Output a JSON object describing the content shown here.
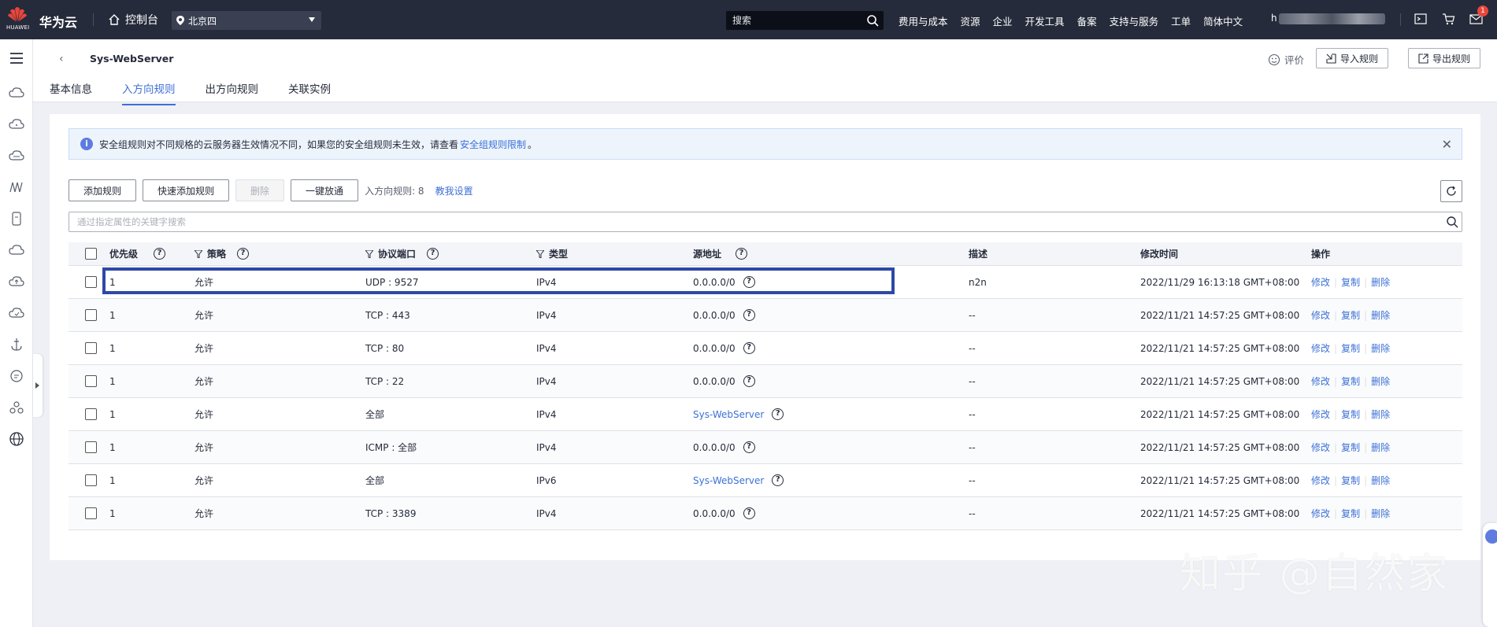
{
  "topbar": {
    "logo_text": "HUAWEI",
    "brand": "华为云",
    "console": "控制台",
    "region": "北京四",
    "search_placeholder": "搜索",
    "nav": [
      "费用与成本",
      "资源",
      "企业",
      "开发工具",
      "备案",
      "支持与服务",
      "工单",
      "简体中文"
    ],
    "user_initial": "h",
    "notification_count": "1"
  },
  "header": {
    "title": "Sys-WebServer",
    "tabs": [
      {
        "label": "基本信息",
        "active": false
      },
      {
        "label": "入方向规则",
        "active": true
      },
      {
        "label": "出方向规则",
        "active": false
      },
      {
        "label": "关联实例",
        "active": false
      }
    ],
    "rate_label": "评价",
    "import_label": "导入规则",
    "export_label": "导出规则"
  },
  "notice": {
    "text": "安全组规则对不同规格的云服务器生效情况不同，如果您的安全组规则未生效，请查看",
    "link": "安全组规则限制",
    "suffix": "。"
  },
  "toolbar": {
    "add": "添加规则",
    "quick_add": "快速添加规则",
    "delete": "删除",
    "allow_all": "一键放通",
    "count": "入方向规则: 8",
    "help": "教我设置"
  },
  "filter_placeholder": "通过指定属性的关键字搜索",
  "table": {
    "headers": {
      "priority": "优先级",
      "policy": "策略",
      "protocol": "协议端口",
      "type": "类型",
      "source": "源地址",
      "desc": "描述",
      "modified": "修改时间",
      "ops": "操作"
    },
    "ops": {
      "edit": "修改",
      "copy": "复制",
      "delete": "删除"
    },
    "rows": [
      {
        "priority": "1",
        "policy": "允许",
        "protocol": "UDP : 9527",
        "type": "IPv4",
        "source": "0.0.0.0/0",
        "desc": "n2n",
        "modified": "2022/11/29 16:13:18 GMT+08:00"
      },
      {
        "priority": "1",
        "policy": "允许",
        "protocol": "TCP : 443",
        "type": "IPv4",
        "source": "0.0.0.0/0",
        "desc": "--",
        "modified": "2022/11/21 14:57:25 GMT+08:00"
      },
      {
        "priority": "1",
        "policy": "允许",
        "protocol": "TCP : 80",
        "type": "IPv4",
        "source": "0.0.0.0/0",
        "desc": "--",
        "modified": "2022/11/21 14:57:25 GMT+08:00"
      },
      {
        "priority": "1",
        "policy": "允许",
        "protocol": "TCP : 22",
        "type": "IPv4",
        "source": "0.0.0.0/0",
        "desc": "--",
        "modified": "2022/11/21 14:57:25 GMT+08:00"
      },
      {
        "priority": "1",
        "policy": "允许",
        "protocol": "全部",
        "type": "IPv4",
        "source": "Sys-WebServer",
        "desc": "--",
        "modified": "2022/11/21 14:57:25 GMT+08:00"
      },
      {
        "priority": "1",
        "policy": "允许",
        "protocol": "ICMP : 全部",
        "type": "IPv4",
        "source": "0.0.0.0/0",
        "desc": "--",
        "modified": "2022/11/21 14:57:25 GMT+08:00"
      },
      {
        "priority": "1",
        "policy": "允许",
        "protocol": "全部",
        "type": "IPv6",
        "source": "Sys-WebServer",
        "desc": "--",
        "modified": "2022/11/21 14:57:25 GMT+08:00"
      },
      {
        "priority": "1",
        "policy": "允许",
        "protocol": "TCP : 3389",
        "type": "IPv4",
        "source": "0.0.0.0/0",
        "desc": "--",
        "modified": "2022/11/21 14:57:25 GMT+08:00"
      }
    ]
  },
  "watermark": "知乎 @自然家",
  "colors": {
    "topbar": "#252b3a",
    "accent": "#3c70d6",
    "highlight_box": "#2f48a7"
  }
}
